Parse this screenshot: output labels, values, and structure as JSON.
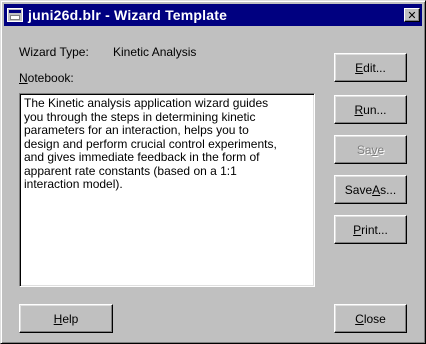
{
  "window": {
    "title": "juni26d.blr - Wizard Template",
    "close_glyph": "✕"
  },
  "wizard_type": {
    "label": "Wizard Type:",
    "value": "Kinetic Analysis"
  },
  "notebook": {
    "label_before": "",
    "label_mnemonic": "N",
    "label_after": "otebook:",
    "text": "The Kinetic analysis application wizard guides\nyou through the steps in determining kinetic\nparameters for an interaction, helps you to\ndesign and perform crucial control experiments,\nand gives immediate feedback in the form of\napparent rate constants (based on a 1:1\ninteraction model)."
  },
  "buttons": {
    "edit": {
      "before": "",
      "mnemonic": "E",
      "after": "dit...",
      "enabled": true
    },
    "run": {
      "before": "",
      "mnemonic": "R",
      "after": "un...",
      "enabled": true
    },
    "save": {
      "before": "Sa",
      "mnemonic": "v",
      "after": "e",
      "enabled": false
    },
    "save_as": {
      "before": "Save ",
      "mnemonic": "A",
      "after": "s...",
      "enabled": true
    },
    "print": {
      "before": "",
      "mnemonic": "P",
      "after": "rint...",
      "enabled": true
    },
    "help": {
      "before": "",
      "mnemonic": "H",
      "after": "elp",
      "enabled": true
    },
    "close": {
      "before": "",
      "mnemonic": "C",
      "after": "lose",
      "enabled": true
    }
  },
  "icons": {
    "app": "wizard-app-icon",
    "close": "close-icon"
  }
}
